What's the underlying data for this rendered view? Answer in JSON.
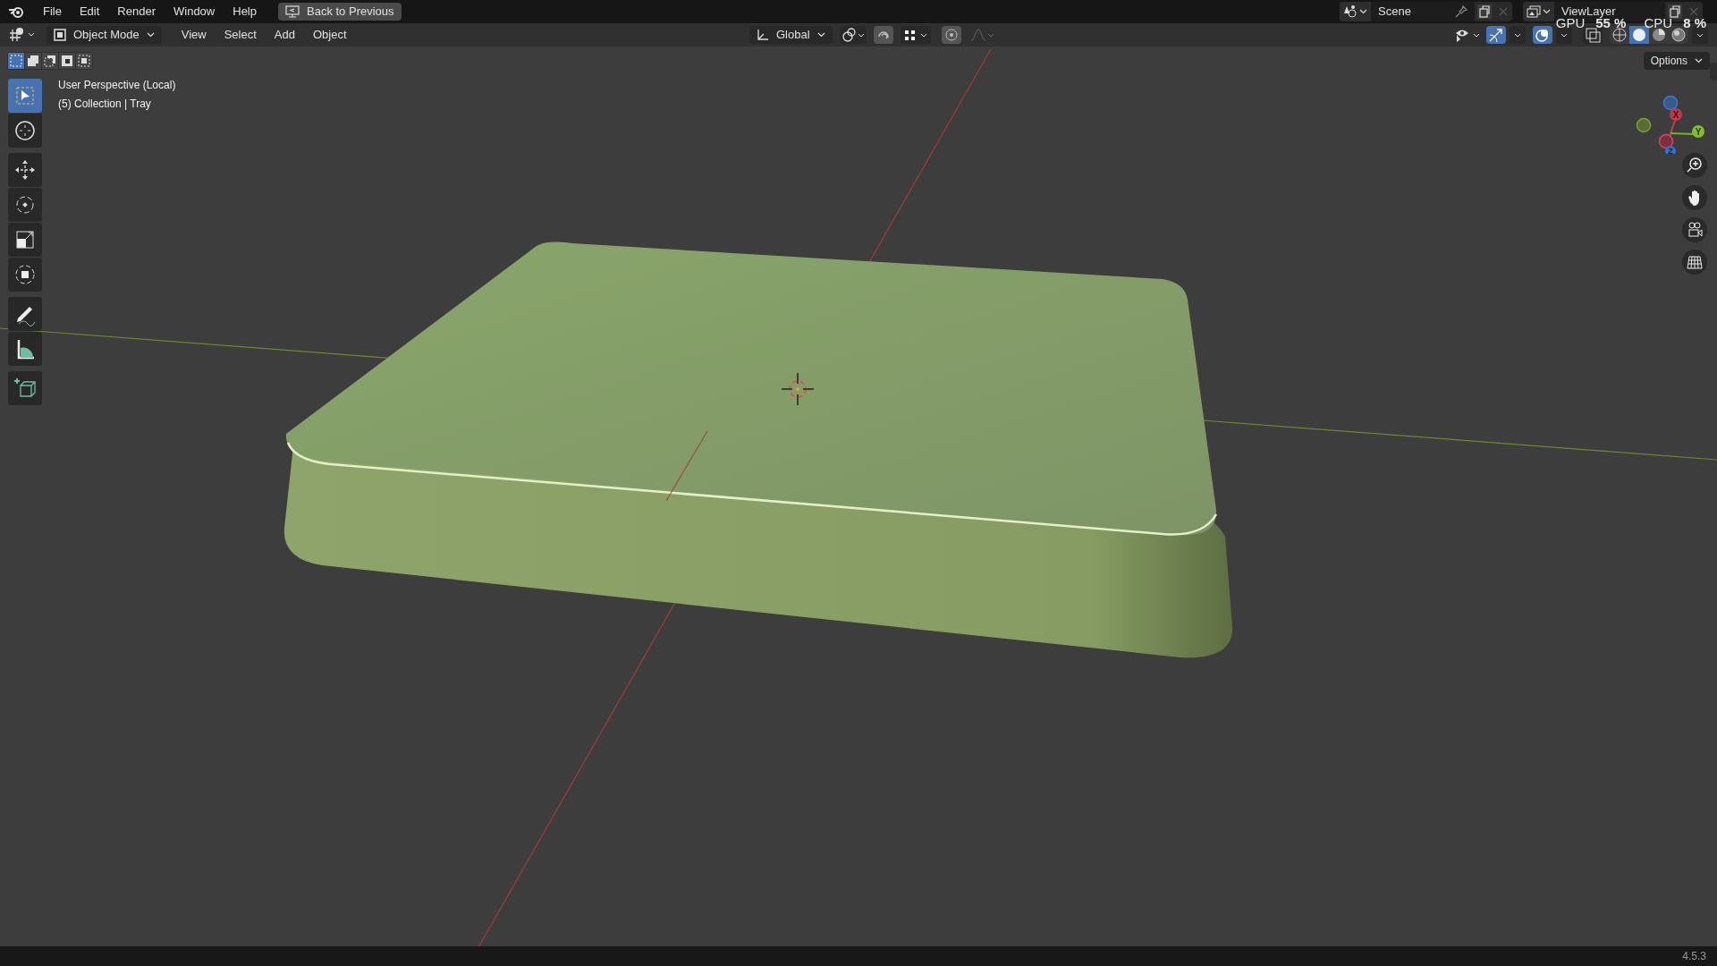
{
  "top_bar": {
    "menus": [
      "File",
      "Edit",
      "Render",
      "Window",
      "Help"
    ],
    "back_button": "Back to Previous",
    "scene": "Scene",
    "view_layer": "ViewLayer"
  },
  "header": {
    "mode": "Object Mode",
    "menus": [
      "View",
      "Select",
      "Add",
      "Object"
    ],
    "orientation": "Global",
    "options": "Options",
    "shading": [
      {
        "kind": "wireframe",
        "selected": false
      },
      {
        "kind": "solid",
        "selected": true
      },
      {
        "kind": "material",
        "selected": false
      },
      {
        "kind": "rendered",
        "selected": false
      }
    ],
    "select_modes": [
      {
        "kind": "new",
        "selected": true
      },
      {
        "kind": "extend",
        "selected": false
      },
      {
        "kind": "subtract",
        "selected": false
      },
      {
        "kind": "invert",
        "selected": false
      },
      {
        "kind": "intersect",
        "selected": false
      }
    ]
  },
  "stats": [
    {
      "label": "GPU",
      "value": "55 %"
    },
    {
      "label": "CPU",
      "value": "8 %"
    }
  ],
  "viewport": {
    "info": [
      "User Perspective (Local)",
      "(5) Collection | Tray"
    ]
  },
  "tools": [
    {
      "kind": "select",
      "selected": true
    },
    {
      "kind": "cursor",
      "selected": false
    },
    {
      "kind": "move",
      "selected": false
    },
    {
      "kind": "rotate",
      "selected": false
    },
    {
      "kind": "scale",
      "selected": false
    },
    {
      "kind": "transform",
      "selected": false
    },
    {
      "kind": "annotate",
      "selected": false
    },
    {
      "kind": "measure",
      "selected": false
    },
    {
      "kind": "add-cube",
      "selected": false
    }
  ],
  "gizmo": {
    "axes": [
      "X",
      "Y",
      "Z"
    ]
  },
  "status_bar": {
    "version": "4.5.3"
  }
}
